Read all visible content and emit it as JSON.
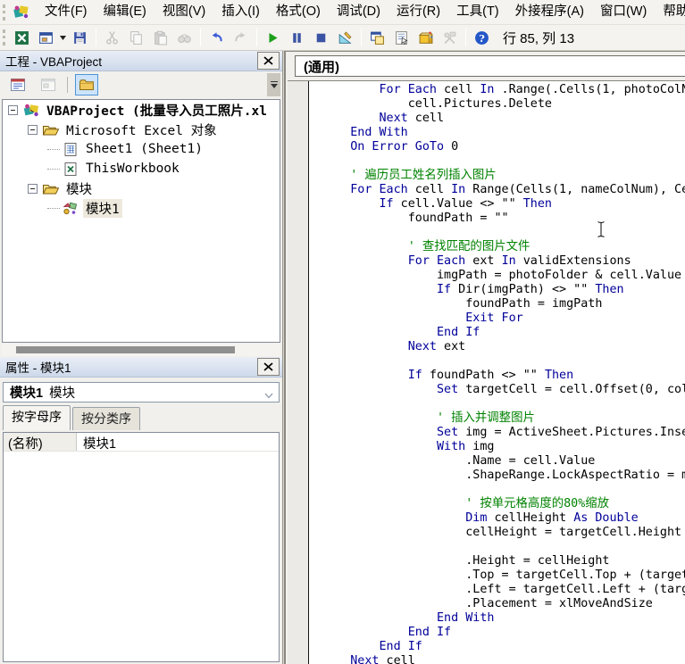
{
  "menu_bar": {
    "items": [
      "文件(F)",
      "编辑(E)",
      "视图(V)",
      "插入(I)",
      "格式(O)",
      "调试(D)",
      "运行(R)",
      "工具(T)",
      "外接程序(A)",
      "窗口(W)",
      "帮助(H)"
    ]
  },
  "toolbar": {
    "status": "行 85, 列 13",
    "buttons": [
      {
        "icon": "excel-icon"
      },
      {
        "icon": "insert-userform-icon",
        "dropdown": true
      },
      {
        "icon": "save-icon"
      },
      {
        "sep": true
      },
      {
        "icon": "cut-icon",
        "disabled": true
      },
      {
        "icon": "copy-icon",
        "disabled": true
      },
      {
        "icon": "paste-icon",
        "disabled": true
      },
      {
        "icon": "find-icon",
        "disabled": true
      },
      {
        "sep": true
      },
      {
        "icon": "undo-icon"
      },
      {
        "icon": "redo-icon",
        "disabled": true
      },
      {
        "sep": true
      },
      {
        "icon": "run-icon"
      },
      {
        "icon": "break-icon"
      },
      {
        "icon": "reset-icon"
      },
      {
        "icon": "design-mode-icon"
      },
      {
        "sep": true
      },
      {
        "icon": "project-explorer-icon"
      },
      {
        "icon": "properties-window-icon"
      },
      {
        "icon": "object-browser-icon"
      },
      {
        "icon": "toolbox-icon",
        "disabled": true
      },
      {
        "sep": true
      },
      {
        "icon": "help-icon"
      }
    ]
  },
  "project_panel": {
    "title": "工程 - VBAProject",
    "toolbar": [
      {
        "icon": "view-code-icon"
      },
      {
        "icon": "view-object-icon",
        "dim": true
      },
      {
        "sep": true
      },
      {
        "icon": "toggle-folders-icon",
        "selected": true
      }
    ],
    "tree": [
      {
        "label": "VBAProject (批量导入员工照片.xl",
        "icon": "vba-project-icon",
        "level": 0,
        "expanded": true,
        "bold": true
      },
      {
        "label": "Microsoft Excel 对象",
        "icon": "folder-icon",
        "level": 1,
        "expanded": true
      },
      {
        "label": "Sheet1 (Sheet1)",
        "icon": "worksheet-icon",
        "level": 2
      },
      {
        "label": "ThisWorkbook",
        "icon": "workbook-icon",
        "level": 2
      },
      {
        "label": "模块",
        "icon": "folder-icon",
        "level": 1,
        "expanded": true
      },
      {
        "label": "模块1",
        "icon": "module-icon",
        "level": 2,
        "selected": true
      }
    ]
  },
  "properties_panel": {
    "title": "属性 - 模块1",
    "object_selector": {
      "name": "模块1",
      "type": "模块"
    },
    "tabs": [
      {
        "label": "按字母序",
        "active": true
      },
      {
        "label": "按分类序",
        "active": false
      }
    ],
    "rows": [
      {
        "name": "(名称)",
        "value": "模块1"
      }
    ]
  },
  "code_window": {
    "object_dropdown": "(通用)",
    "lines": [
      [
        8,
        [
          [
            "For Each",
            "k"
          ],
          [
            " cell ",
            "t"
          ],
          [
            "In",
            "k"
          ],
          [
            " .Range(.Cells(1, photoColN",
            "t"
          ]
        ]
      ],
      [
        12,
        [
          [
            "cell.Pictures.Delete",
            "t"
          ]
        ]
      ],
      [
        8,
        [
          [
            "Next",
            "k"
          ],
          [
            " cell",
            "t"
          ]
        ]
      ],
      [
        4,
        [
          [
            "End With",
            "k"
          ]
        ]
      ],
      [
        4,
        [
          [
            "On Error GoTo",
            "k"
          ],
          [
            " 0",
            "t"
          ]
        ]
      ],
      [
        0,
        []
      ],
      [
        4,
        [
          [
            "' 遍历员工姓名列插入图片",
            "c"
          ]
        ]
      ],
      [
        4,
        [
          [
            "For Each",
            "k"
          ],
          [
            " cell ",
            "t"
          ],
          [
            "In",
            "k"
          ],
          [
            " Range(Cells(1, nameColNum), Ce",
            "t"
          ]
        ]
      ],
      [
        8,
        [
          [
            "If",
            "k"
          ],
          [
            " cell.Value <> \"\" ",
            "t"
          ],
          [
            "Then",
            "k"
          ]
        ]
      ],
      [
        12,
        [
          [
            "foundPath = \"\"",
            "t"
          ]
        ]
      ],
      [
        0,
        []
      ],
      [
        12,
        [
          [
            "' 查找匹配的图片文件",
            "c"
          ]
        ]
      ],
      [
        12,
        [
          [
            "For Each",
            "k"
          ],
          [
            " ext ",
            "t"
          ],
          [
            "In",
            "k"
          ],
          [
            " validExtensions",
            "t"
          ]
        ]
      ],
      [
        16,
        [
          [
            "imgPath = photoFolder & cell.Value",
            "t"
          ]
        ]
      ],
      [
        16,
        [
          [
            "If",
            "k"
          ],
          [
            " Dir(imgPath) <> \"\" ",
            "t"
          ],
          [
            "Then",
            "k"
          ]
        ]
      ],
      [
        20,
        [
          [
            "foundPath = imgPath",
            "t"
          ]
        ]
      ],
      [
        20,
        [
          [
            "Exit For",
            "k"
          ]
        ]
      ],
      [
        16,
        [
          [
            "End If",
            "k"
          ]
        ]
      ],
      [
        12,
        [
          [
            "Next",
            "k"
          ],
          [
            " ext",
            "t"
          ]
        ]
      ],
      [
        0,
        []
      ],
      [
        12,
        [
          [
            "If",
            "k"
          ],
          [
            " foundPath <> \"\" ",
            "t"
          ],
          [
            "Then",
            "k"
          ]
        ]
      ],
      [
        16,
        [
          [
            "Set",
            "k"
          ],
          [
            " targetCell = cell.Offset(0, col",
            "t"
          ]
        ]
      ],
      [
        0,
        []
      ],
      [
        16,
        [
          [
            "' 插入并调整图片",
            "c"
          ]
        ]
      ],
      [
        16,
        [
          [
            "Set",
            "k"
          ],
          [
            " img = ActiveSheet.Pictures.Inse",
            "t"
          ]
        ]
      ],
      [
        16,
        [
          [
            "With",
            "k"
          ],
          [
            " img",
            "t"
          ]
        ]
      ],
      [
        20,
        [
          [
            ".Name = cell.Value",
            "t"
          ]
        ]
      ],
      [
        20,
        [
          [
            ".ShapeRange.LockAspectRatio = m",
            "t"
          ]
        ]
      ],
      [
        0,
        []
      ],
      [
        20,
        [
          [
            "' 按单元格高度的80%缩放",
            "c"
          ]
        ]
      ],
      [
        20,
        [
          [
            "Dim",
            "k"
          ],
          [
            " cellHeight ",
            "t"
          ],
          [
            "As Double",
            "k"
          ]
        ]
      ],
      [
        20,
        [
          [
            "cellHeight = targetCell.Height",
            "t"
          ]
        ]
      ],
      [
        0,
        []
      ],
      [
        20,
        [
          [
            ".Height = cellHeight",
            "t"
          ]
        ]
      ],
      [
        20,
        [
          [
            ".Top = targetCell.Top + (target",
            "t"
          ]
        ]
      ],
      [
        20,
        [
          [
            ".Left = targetCell.Left + (targ",
            "t"
          ]
        ]
      ],
      [
        20,
        [
          [
            ".Placement = xlMoveAndSize",
            "t"
          ]
        ]
      ],
      [
        16,
        [
          [
            "End With",
            "k"
          ]
        ]
      ],
      [
        12,
        [
          [
            "End If",
            "k"
          ]
        ]
      ],
      [
        8,
        [
          [
            "End If",
            "k"
          ]
        ]
      ],
      [
        4,
        [
          [
            "Next",
            "k"
          ],
          [
            " cell",
            "t"
          ]
        ]
      ]
    ]
  },
  "colors": {
    "keyword": "#00009a",
    "comment": "#008200",
    "selection": "#ede9dd",
    "titlebar_top": "#eaeff7",
    "titlebar_bottom": "#ccd8ea"
  }
}
